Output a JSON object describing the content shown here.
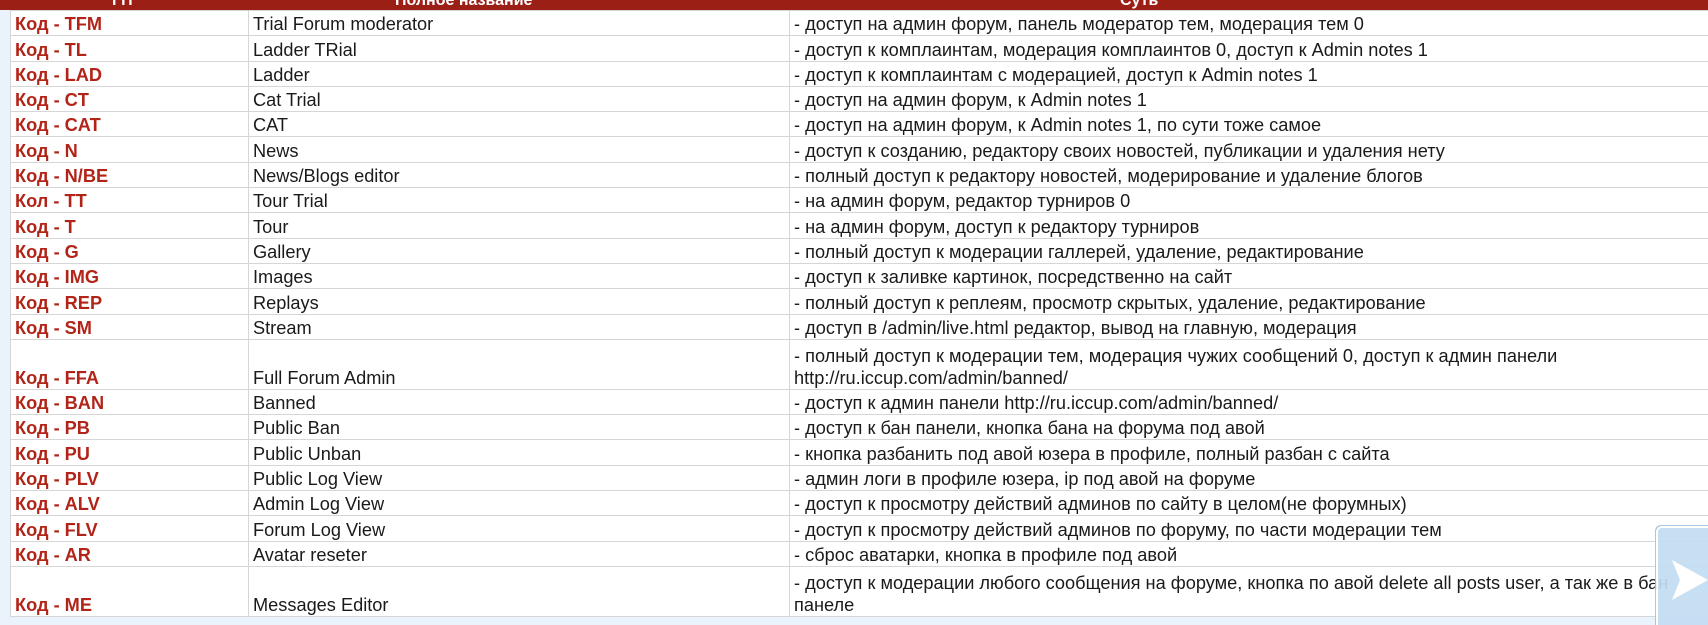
{
  "header": {
    "col1": "ГП",
    "col2": "Полное название",
    "col3": "Суть"
  },
  "rows": [
    {
      "code": "Код - TFM",
      "name": "Trial Forum moderator",
      "desc": "- доступ на админ форум, панель модератор тем, модерация тем 0"
    },
    {
      "code": "Код - TL",
      "name": "Ladder TRial",
      "desc": "- доступ к комплаинтам, модерация комплаинтов 0, доступ к Admin notes 1"
    },
    {
      "code": "Код - LAD",
      "name": "Ladder",
      "desc": "- доступ к комплаинтам с модерацией, доступ к Admin notes 1"
    },
    {
      "code": "Код - CT",
      "name": "Cat Trial",
      "desc": "- доступ на админ форум, к Admin notes 1"
    },
    {
      "code": "Код - CAT",
      "name": "CAT",
      "desc": "- доступ на админ форум, к Admin notes 1, по сути тоже самое"
    },
    {
      "code": "Код - N",
      "name": "News",
      "desc": "- доступ к созданию, редактору своих новостей, публикации и удаления нету"
    },
    {
      "code": "Код - N/BE",
      "name": "News/Blogs editor",
      "desc": "- полный доступ к редактору новостей, модерирование и удаление блогов"
    },
    {
      "code": "Кол - TT",
      "name": "Tour Trial",
      "desc": "- на админ форум, редактор турниров 0"
    },
    {
      "code": "Код - T",
      "name": "Tour",
      "desc": "- на админ форум, доступ к редактору турниров"
    },
    {
      "code": "Код - G",
      "name": "Gallery",
      "desc": "- полный доступ к модерации галлерей, удаление, редактирование"
    },
    {
      "code": "Код - IMG",
      "name": "Images",
      "desc": "- доступ к заливке картинок, посредственно на сайт"
    },
    {
      "code": "Код - REP",
      "name": "Replays",
      "desc": "- полный доступ к реплеям, просмотр скрытых, удаление, редактирование"
    },
    {
      "code": "Код - SM",
      "name": "Stream",
      "desc": "- доступ в /admin/live.html редактор, вывод на главную, модерация"
    },
    {
      "code": "Код - FFA",
      "name": "Full Forum Admin",
      "desc": "- полный доступ к модерации тем, модерация чужих сообщений 0, доступ к админ панели http://ru.iccup.com/admin/banned/",
      "tall": true
    },
    {
      "code": "Код - BAN",
      "name": "Banned",
      "desc": "- доступ к админ панели http://ru.iccup.com/admin/banned/"
    },
    {
      "code": "Код - PB",
      "name": "Public Ban",
      "desc": "- доступ к бан панели, кнопка бана на форума под авой"
    },
    {
      "code": "Код - PU",
      "name": "Public Unban",
      "desc": "- кнопка разбанить под авой юзера в профиле, полный разбан с сайта"
    },
    {
      "code": "Код - PLV",
      "name": "Public Log View",
      "desc": "- админ логи в профиле юзера, ip под авой на форуме"
    },
    {
      "code": "Код - ALV",
      "name": "Admin Log View",
      "desc": "- доступ к просмотру действий админов по сайту в целом(не форумных)"
    },
    {
      "code": "Код - FLV",
      "name": "Forum Log View",
      "desc": "- доступ к просмотру действий админов по форуму, по части модерации тем"
    },
    {
      "code": "Код - AR",
      "name": "Avatar reseter",
      "desc": "- сброс аватарки, кнопка в профиле под авой"
    },
    {
      "code": "Код - ME",
      "name": "Messages Editor",
      "desc": "- доступ к модерации любого сообщения на форуме, кнопка по авой delete all posts user, а так же в бан панеле",
      "tall": true
    }
  ],
  "colors": {
    "header_bg": "#9c1f15",
    "code_text": "#b22418",
    "grid_line": "#d6d6d6",
    "nav_button": "#c2ddf3"
  },
  "icons": {
    "nav": "next-slide-arrow-icon"
  }
}
